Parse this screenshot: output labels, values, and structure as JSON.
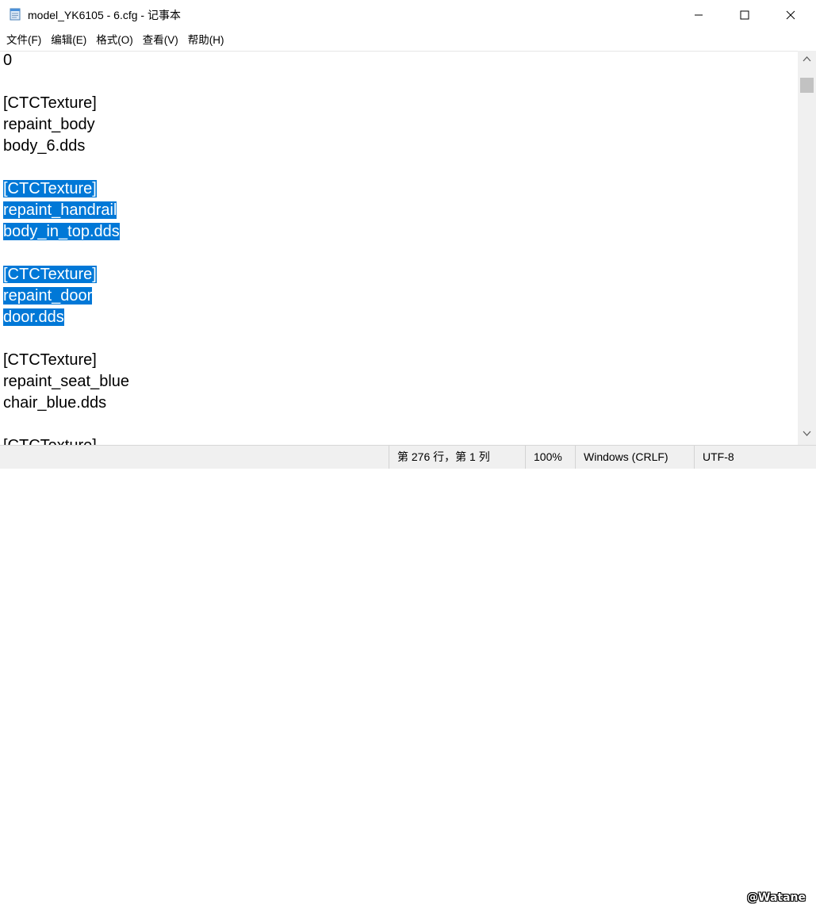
{
  "window": {
    "title": "model_YK6105 - 6.cfg - 记事本",
    "icon": "notepad-icon",
    "controls": [
      "minimize-icon",
      "maximize-icon",
      "close-icon"
    ]
  },
  "menu": {
    "items": [
      "文件(F)",
      "编辑(E)",
      "格式(O)",
      "查看(V)",
      "帮助(H)"
    ]
  },
  "editor": {
    "lines": [
      "0",
      "",
      "[CTCTexture]",
      "repaint_body",
      "body_6.dds",
      "",
      "[CTCTexture]",
      "repaint_handrail",
      "body_in_top.dds",
      "",
      "[CTCTexture]",
      "repaint_door",
      "door.dds",
      "",
      "[CTCTexture]",
      "repaint_seat_blue",
      "chair_blue.dds",
      "",
      "[CTCTexture]"
    ],
    "selected_lines": [
      6,
      7,
      8,
      10,
      11,
      12
    ],
    "selection_color": "#0078d7"
  },
  "status": {
    "position": "第 276 行，第 1 列",
    "zoom": "100%",
    "line_ending": "Windows (CRLF)",
    "encoding": "UTF-8"
  },
  "watermark": "@Watane"
}
